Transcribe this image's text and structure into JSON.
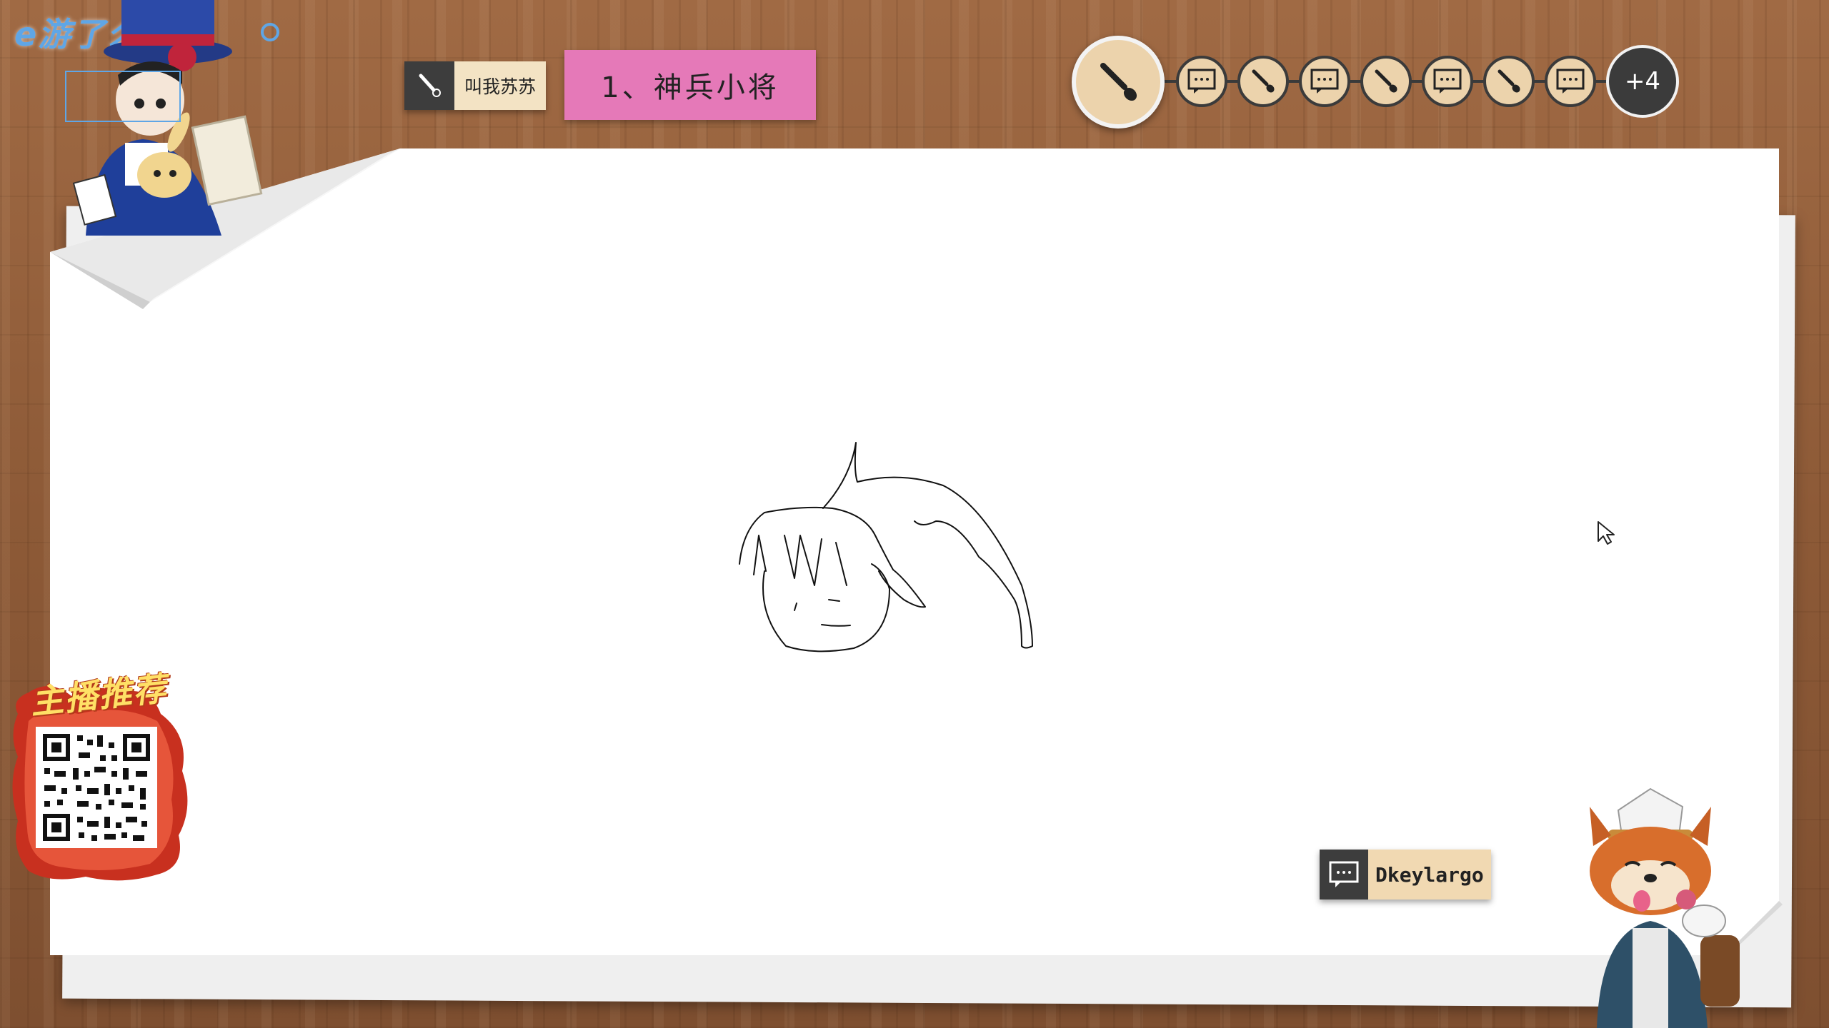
{
  "logo": {
    "text": "e游了么"
  },
  "drawer": {
    "name": "叫我苏苏",
    "icon": "brush-icon"
  },
  "word": {
    "text": "1、神兵小将"
  },
  "rounds": {
    "items": [
      "brush-icon",
      "chat-icon",
      "brush-icon",
      "chat-icon",
      "brush-icon",
      "chat-icon",
      "brush-icon",
      "chat-icon"
    ],
    "more_label": "+4"
  },
  "chat": {
    "name": "Dkeylargo",
    "icon": "chat-icon"
  },
  "promo": {
    "title": "主播推荐"
  },
  "colors": {
    "wood": "#8d5a37",
    "word_banner": "#e579b8",
    "tag_cream": "#f3e3c4",
    "dark": "#3d3d3d",
    "logo_blue": "#5fa6e6"
  }
}
